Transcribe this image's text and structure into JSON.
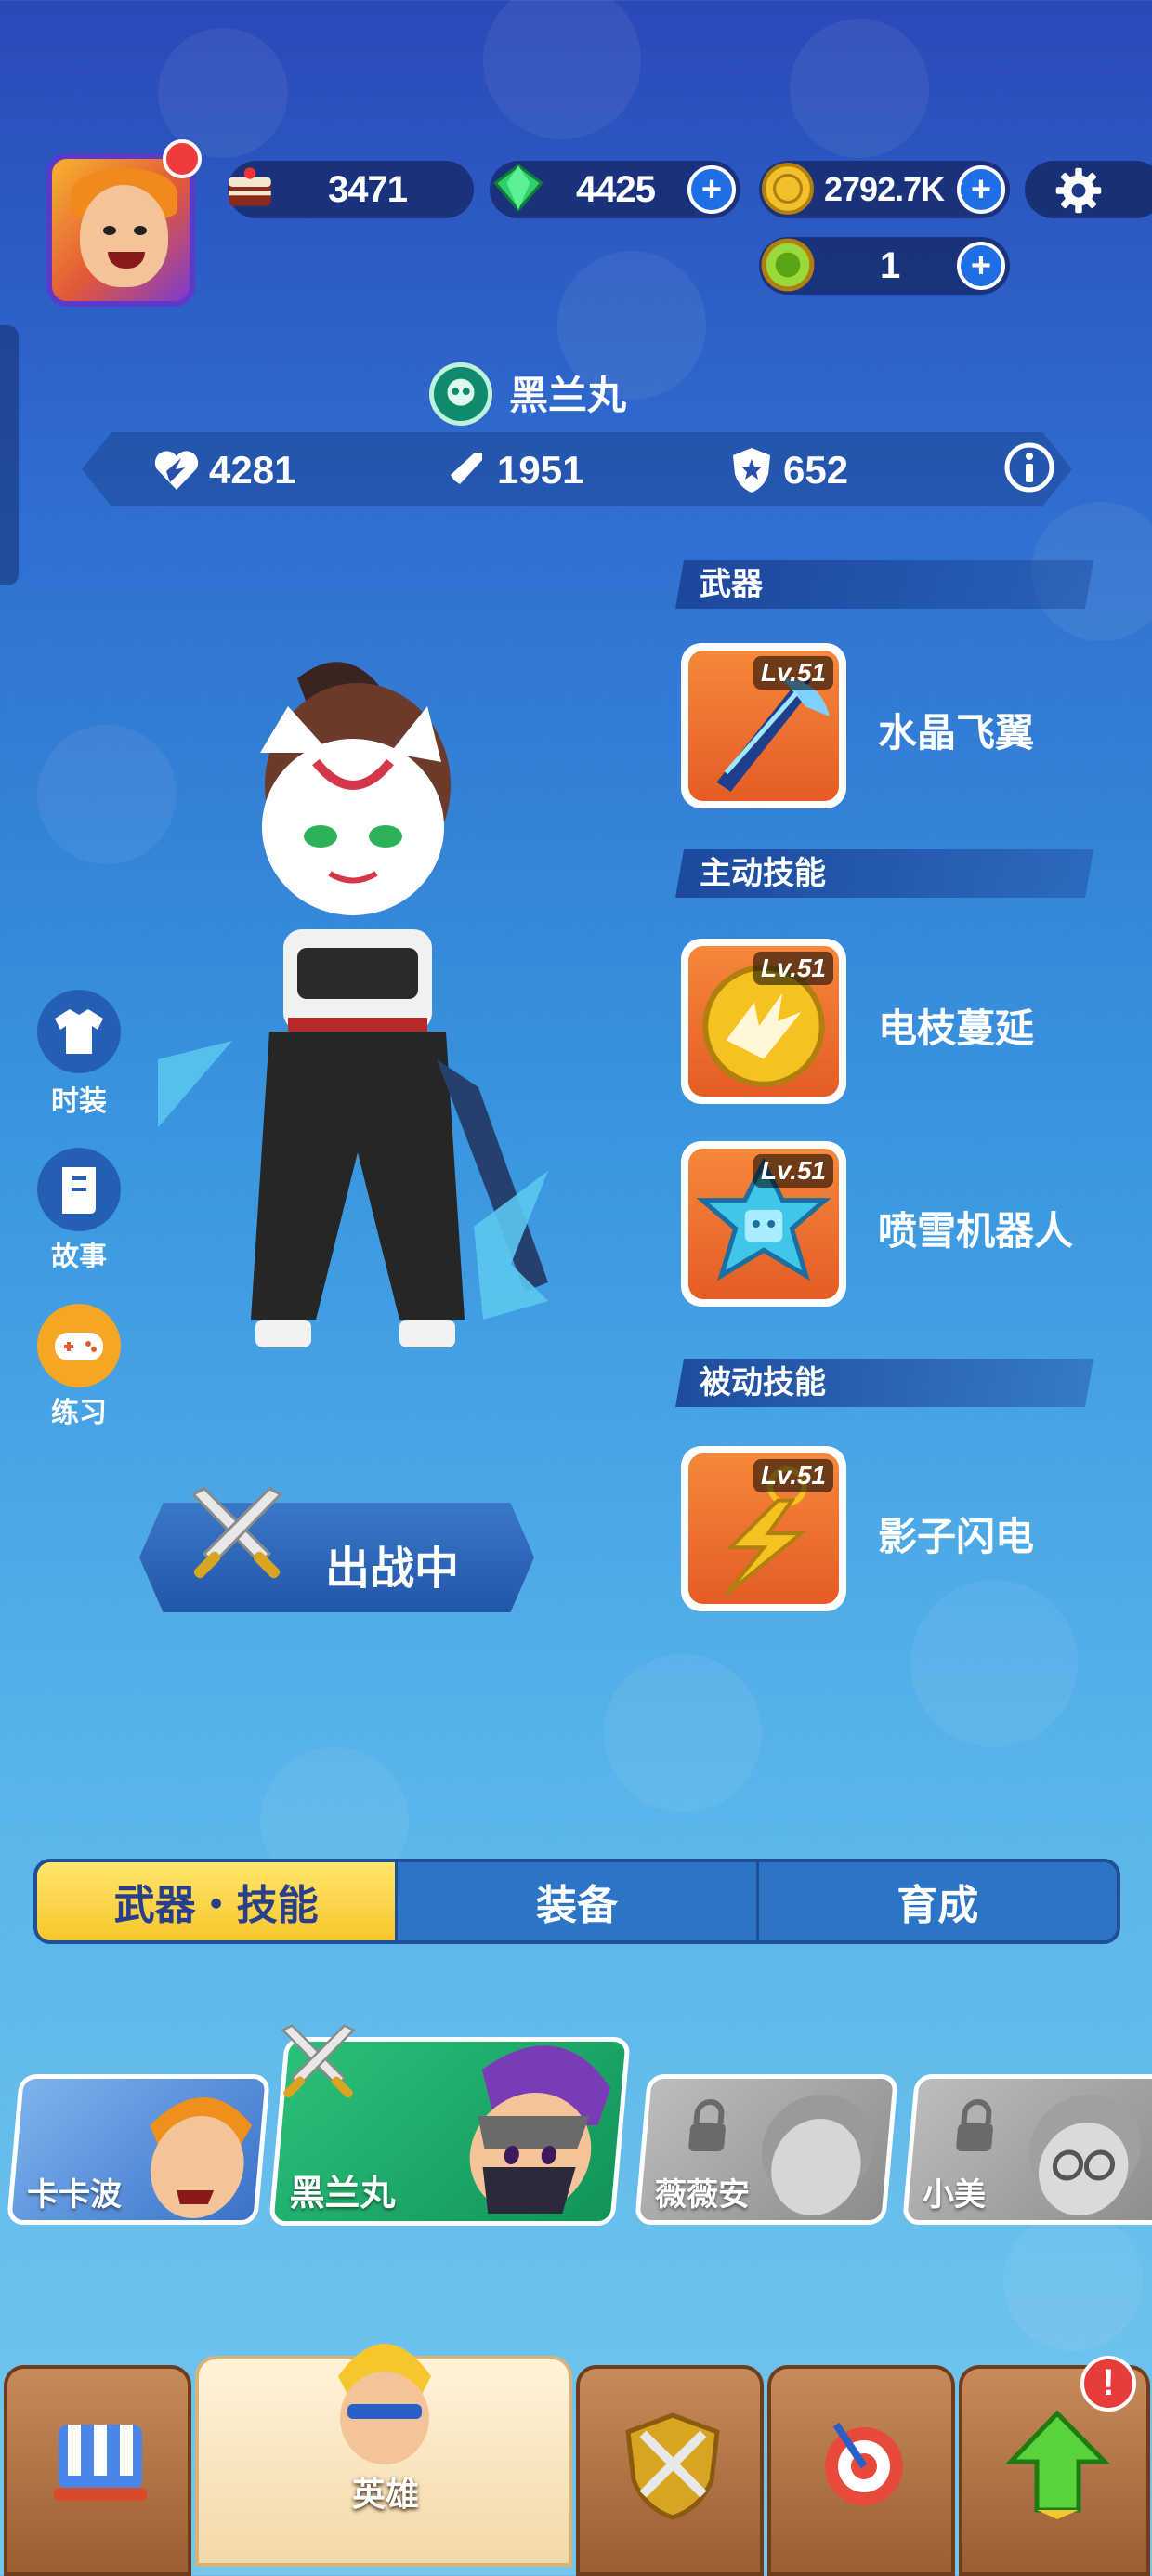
{
  "resources": {
    "cake": "3471",
    "gems": "4425",
    "gold": "2792.7K",
    "token": "1"
  },
  "hero": {
    "name": "黑兰丸",
    "stats": {
      "hp": "4281",
      "attack": "1951",
      "defense": "652"
    },
    "status": "出战中"
  },
  "sections": {
    "weapon": {
      "title": "武器",
      "items": [
        {
          "level": "Lv.51",
          "name": "水晶飞翼"
        }
      ]
    },
    "active": {
      "title": "主动技能",
      "items": [
        {
          "level": "Lv.51",
          "name": "电枝蔓延"
        },
        {
          "level": "Lv.51",
          "name": "喷雪机器人"
        }
      ]
    },
    "passive": {
      "title": "被动技能",
      "items": [
        {
          "level": "Lv.51",
          "name": "影子闪电"
        }
      ]
    }
  },
  "side_buttons": {
    "outfit": "时装",
    "story": "故事",
    "practice": "练习"
  },
  "tabs": [
    "武器・技能",
    "装备",
    "育成"
  ],
  "heroes": [
    {
      "name": "卡卡波",
      "locked": false
    },
    {
      "name": "黑兰丸",
      "locked": false
    },
    {
      "name": "薇薇安",
      "locked": true
    },
    {
      "name": "小美",
      "locked": true
    }
  ],
  "nav": {
    "hero_label": "英雄",
    "alert": "!"
  },
  "colors": {
    "accent_yellow": "#f7c62c",
    "panel_blue": "#1b4296",
    "skill_orange": "#e55c26",
    "hero_green": "#1aa86a"
  }
}
